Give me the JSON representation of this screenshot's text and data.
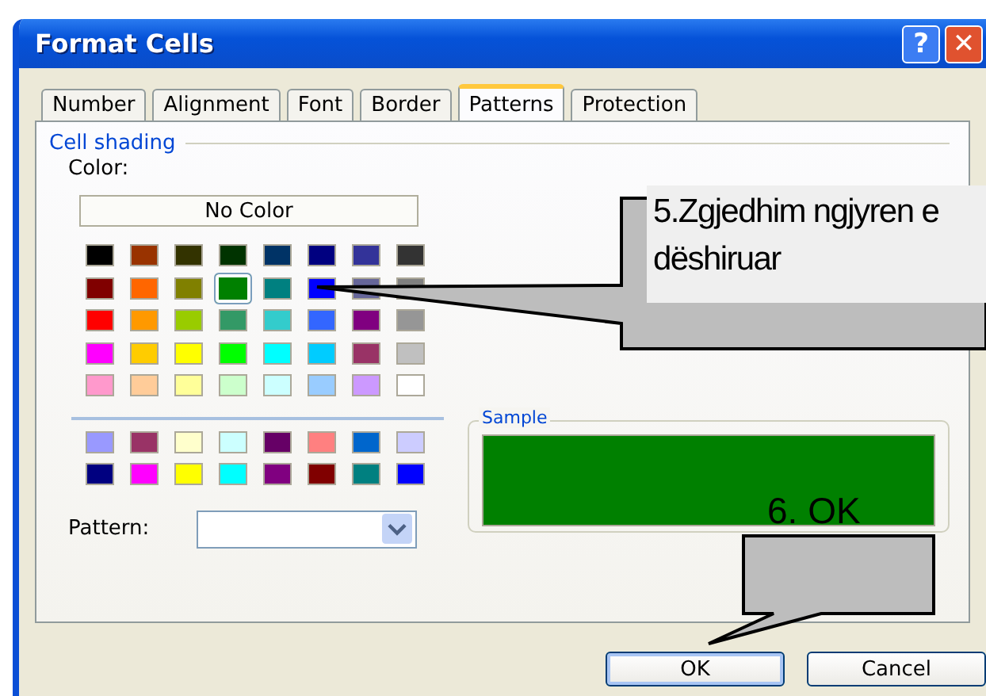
{
  "window": {
    "title": "Format Cells",
    "buttons": [
      "?",
      "✕"
    ]
  },
  "tabs": [
    {
      "label": "Number",
      "selected": false
    },
    {
      "label": "Alignment",
      "selected": false
    },
    {
      "label": "Font",
      "selected": false
    },
    {
      "label": "Border",
      "selected": false
    },
    {
      "label": "Patterns",
      "selected": true
    },
    {
      "label": "Protection",
      "selected": false
    }
  ],
  "cell_shading": {
    "title": "Cell shading",
    "color_label": "Color:",
    "no_color": "No Color",
    "palette": [
      [
        {
          "color": "#000000",
          "selected": false
        },
        {
          "color": "#993300",
          "selected": false
        },
        {
          "color": "#333300",
          "selected": false
        },
        {
          "color": "#003300",
          "selected": false
        },
        {
          "color": "#003366",
          "selected": false
        },
        {
          "color": "#000080",
          "selected": false
        },
        {
          "color": "#333399",
          "selected": false
        },
        {
          "color": "#333333",
          "selected": false
        }
      ],
      [
        {
          "color": "#800000",
          "selected": false
        },
        {
          "color": "#ff6600",
          "selected": false
        },
        {
          "color": "#808000",
          "selected": false
        },
        {
          "color": "#008000",
          "selected": true
        },
        {
          "color": "#008080",
          "selected": false
        },
        {
          "color": "#0000ff",
          "selected": false
        },
        {
          "color": "#666699",
          "selected": false
        },
        {
          "color": "#808080",
          "selected": false
        }
      ],
      [
        {
          "color": "#ff0000",
          "selected": false
        },
        {
          "color": "#ff9900",
          "selected": false
        },
        {
          "color": "#99cc00",
          "selected": false
        },
        {
          "color": "#339966",
          "selected": false
        },
        {
          "color": "#33cccc",
          "selected": false
        },
        {
          "color": "#3366ff",
          "selected": false
        },
        {
          "color": "#800080",
          "selected": false
        },
        {
          "color": "#969696",
          "selected": false
        }
      ],
      [
        {
          "color": "#ff00ff",
          "selected": false
        },
        {
          "color": "#ffcc00",
          "selected": false
        },
        {
          "color": "#ffff00",
          "selected": false
        },
        {
          "color": "#00ff00",
          "selected": false
        },
        {
          "color": "#00ffff",
          "selected": false
        },
        {
          "color": "#00ccff",
          "selected": false
        },
        {
          "color": "#993366",
          "selected": false
        },
        {
          "color": "#c0c0c0",
          "selected": false
        }
      ],
      [
        {
          "color": "#ff99cc",
          "selected": false
        },
        {
          "color": "#ffcc99",
          "selected": false
        },
        {
          "color": "#ffff99",
          "selected": false
        },
        {
          "color": "#ccffcc",
          "selected": false
        },
        {
          "color": "#ccffff",
          "selected": false
        },
        {
          "color": "#99ccff",
          "selected": false
        },
        {
          "color": "#cc99ff",
          "selected": false
        },
        {
          "color": "#ffffff",
          "selected": false
        }
      ]
    ],
    "chart_palette": [
      [
        {
          "color": "#9999ff",
          "selected": false
        },
        {
          "color": "#993366",
          "selected": false
        },
        {
          "color": "#ffffcc",
          "selected": false
        },
        {
          "color": "#ccffff",
          "selected": false
        },
        {
          "color": "#660066",
          "selected": false
        },
        {
          "color": "#ff8080",
          "selected": false
        },
        {
          "color": "#0066cc",
          "selected": false
        },
        {
          "color": "#ccccff",
          "selected": false
        }
      ],
      [
        {
          "color": "#000080",
          "selected": false
        },
        {
          "color": "#ff00ff",
          "selected": false
        },
        {
          "color": "#ffff00",
          "selected": false
        },
        {
          "color": "#00ffff",
          "selected": false
        },
        {
          "color": "#800080",
          "selected": false
        },
        {
          "color": "#800000",
          "selected": false
        },
        {
          "color": "#008080",
          "selected": false
        },
        {
          "color": "#0000ff",
          "selected": false
        }
      ]
    ],
    "pattern_label": "Pattern:"
  },
  "sample": {
    "label": "Sample"
  },
  "callouts": [
    "5.Zgjedhim ngjyren e dëshiruar",
    "6. OK"
  ],
  "buttons": [
    {
      "label": "OK",
      "default": true
    },
    {
      "label": "Cancel",
      "default": false
    }
  ]
}
